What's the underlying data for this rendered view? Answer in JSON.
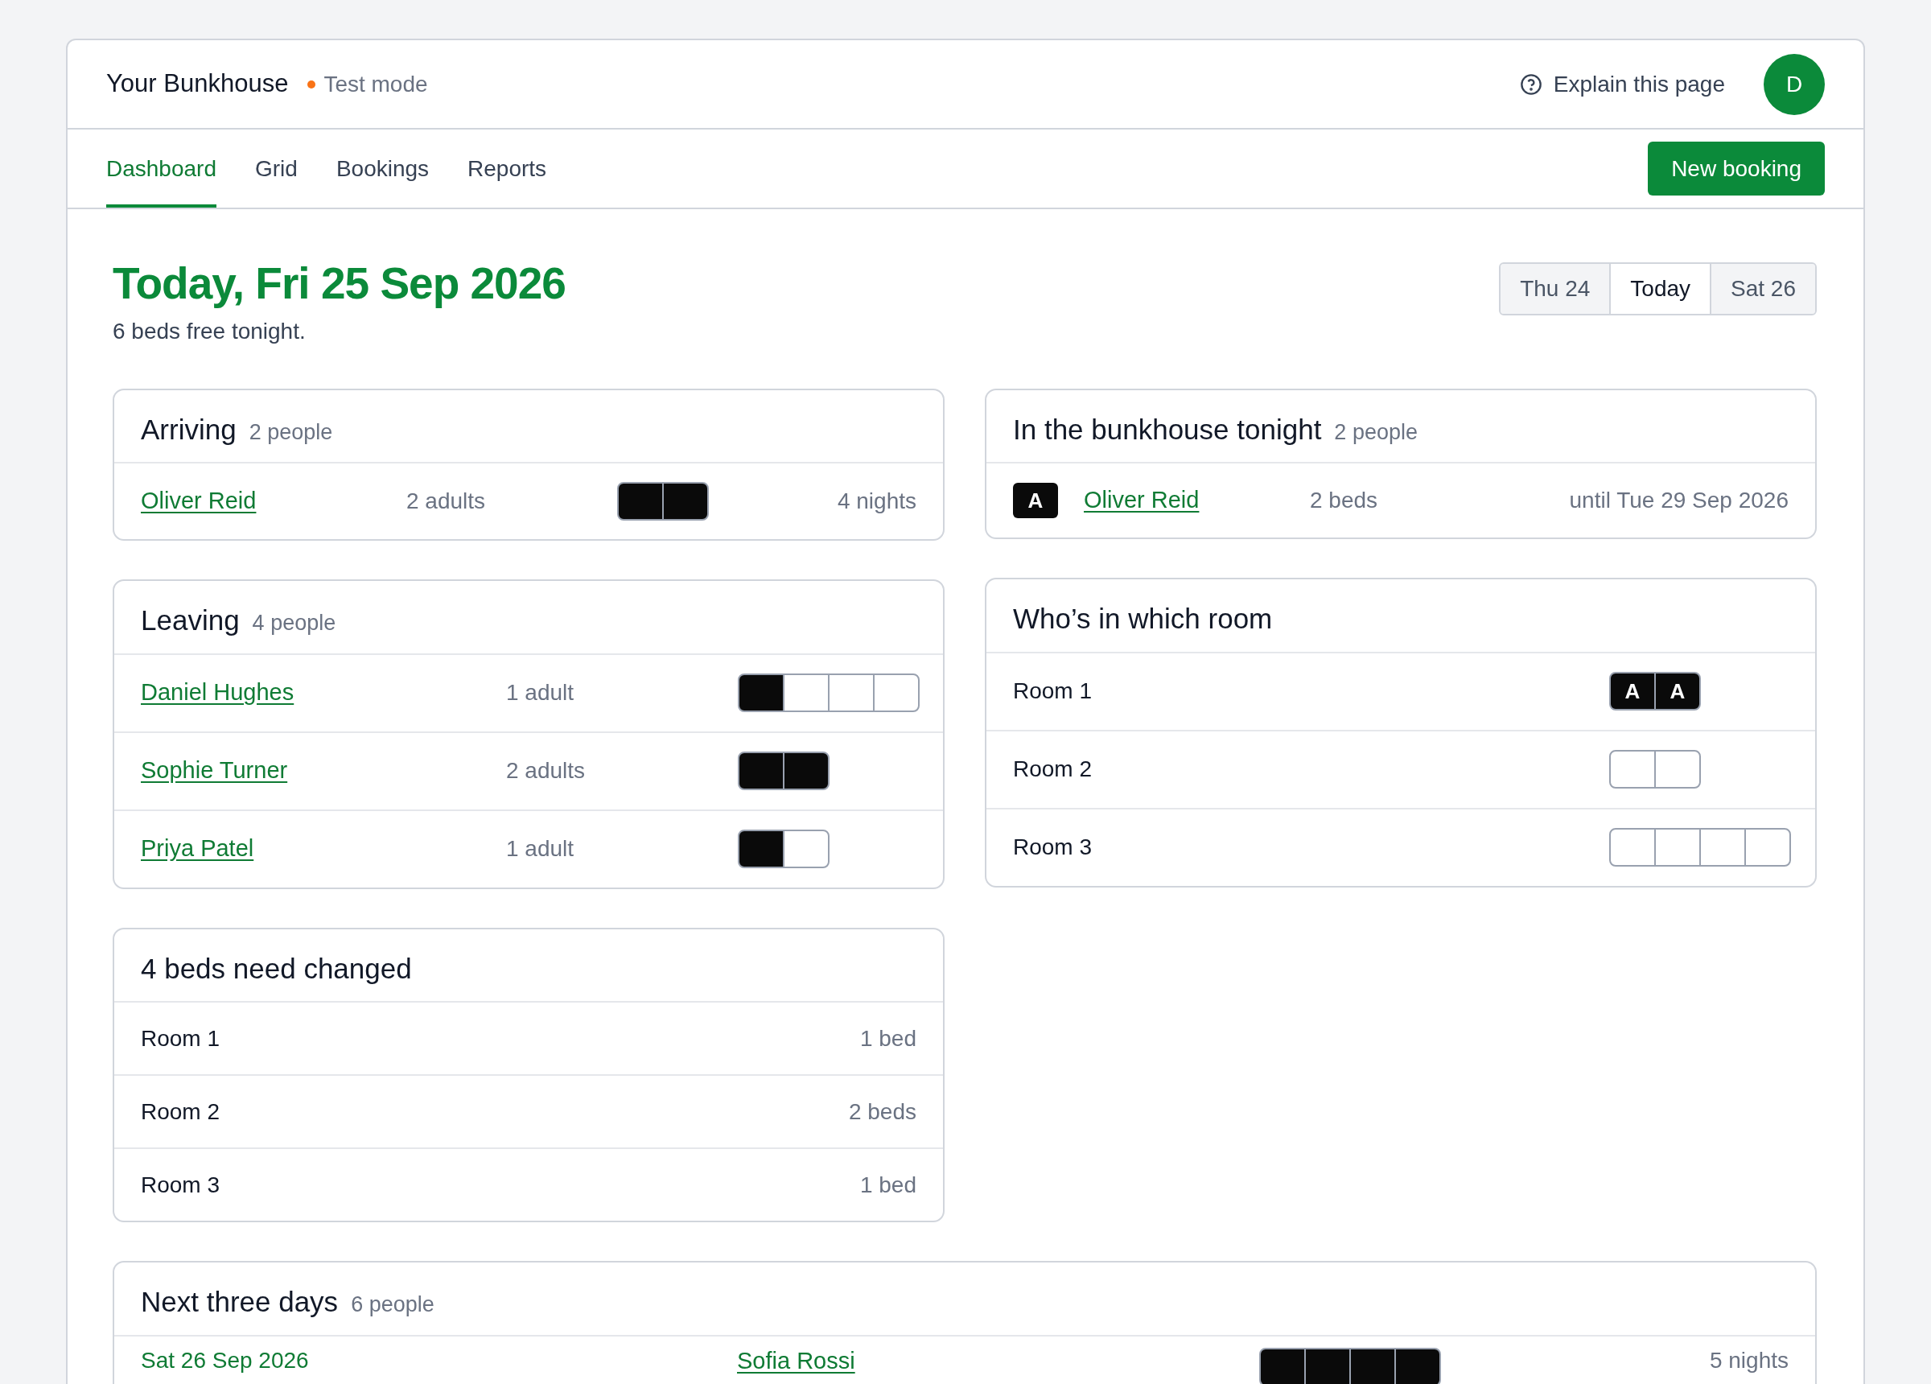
{
  "header": {
    "title": "Your Bunkhouse",
    "mode": {
      "label": "Test mode",
      "color": "#f97316"
    },
    "help": "Explain this page",
    "avatar": "D"
  },
  "tabs": [
    {
      "label": "Dashboard",
      "selected": true
    },
    {
      "label": "Grid",
      "selected": false
    },
    {
      "label": "Bookings",
      "selected": false
    },
    {
      "label": "Reports",
      "selected": false
    }
  ],
  "new_booking": "New booking",
  "heading": "Today, Fri 25 Sep 2026",
  "subheading": "6 beds free tonight.",
  "day_switcher": [
    {
      "label": "Thu 24",
      "selected": false
    },
    {
      "label": "Today",
      "selected": true
    },
    {
      "label": "Sat 26",
      "selected": false
    }
  ],
  "arriving": {
    "title": "Arriving",
    "count": "2 people",
    "rows": [
      {
        "name": "Oliver Reid",
        "guests": "2 adults",
        "beds": [
          {
            "occupied": true
          },
          {
            "occupied": true
          }
        ],
        "nights": "4 nights"
      }
    ]
  },
  "leaving": {
    "title": "Leaving",
    "count": "4 people",
    "rows": [
      {
        "name": "Daniel Hughes",
        "guests": "1 adult",
        "beds": [
          {
            "occupied": true
          },
          {
            "occupied": false
          },
          {
            "occupied": false
          },
          {
            "occupied": false
          }
        ]
      },
      {
        "name": "Sophie Turner",
        "guests": "2 adults",
        "beds": [
          {
            "occupied": true
          },
          {
            "occupied": true
          }
        ]
      },
      {
        "name": "Priya Patel",
        "guests": "1 adult",
        "beds": [
          {
            "occupied": true
          },
          {
            "occupied": false
          }
        ]
      }
    ]
  },
  "beds_to_change": {
    "title": "4 beds need changed",
    "rows": [
      {
        "room": "Room 1",
        "beds": "1 bed"
      },
      {
        "room": "Room 2",
        "beds": "2 beds"
      },
      {
        "room": "Room 3",
        "beds": "1 bed"
      }
    ]
  },
  "tonight": {
    "title": "In the bunkhouse tonight",
    "count": "2 people",
    "rows": [
      {
        "badge": "A",
        "name": "Oliver Reid",
        "beds": "2 beds",
        "until": "until Tue 29 Sep 2026"
      }
    ]
  },
  "rooms": {
    "title": "Who’s in which room",
    "rows": [
      {
        "room": "Room 1",
        "beds": [
          {
            "occupied": true,
            "label": "A"
          },
          {
            "occupied": true,
            "label": "A"
          }
        ]
      },
      {
        "room": "Room 2",
        "beds": [
          {
            "occupied": false
          },
          {
            "occupied": false
          }
        ]
      },
      {
        "room": "Room 3",
        "beds": [
          {
            "occupied": false
          },
          {
            "occupied": false
          },
          {
            "occupied": false
          },
          {
            "occupied": false
          }
        ]
      }
    ]
  },
  "next_three_days": {
    "title": "Next three days",
    "count": "6 people",
    "rows": [
      {
        "date": "Sat 26 Sep 2026",
        "name": "Sofia Rossi",
        "beds": [
          {
            "occupied": true
          },
          {
            "occupied": true
          },
          {
            "occupied": true
          },
          {
            "occupied": true
          }
        ],
        "nights": "5 nights"
      }
    ]
  }
}
